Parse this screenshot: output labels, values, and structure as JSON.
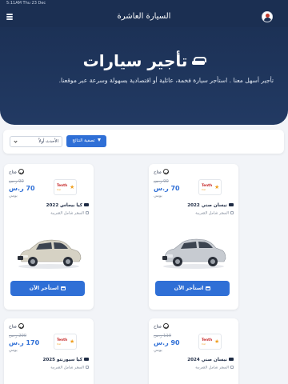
{
  "status_bar": {
    "text": "5:11AM  Thu 23 Dec"
  },
  "app_bar": {
    "title": "السيارة العاشرة"
  },
  "hero": {
    "title": "تأجير سيارات",
    "subtitle": "تأجير أسهل معنا . استأجر سيارة فخمة، عائلية أو اقتصادية بسهولة وسرعة عبر موقعنا."
  },
  "filters": {
    "filter_button_label": "تصفية النتائج",
    "sort_value": "الأحدث أولاً"
  },
  "cards": [
    {
      "status": "متاح",
      "old_price": "90 ر.س",
      "price": "70 ر.س",
      "unit": "يومي",
      "name": "نيسان صني 2022",
      "tax_note": "السعر شامل الضريبة",
      "button": "استأجر الآن",
      "logo_line1": "Tenth",
      "logo_line2": "Car",
      "car_color": "#c7cbd1"
    },
    {
      "status": "متاح",
      "old_price": "90 ر.س",
      "price": "70 ر.س",
      "unit": "يومي",
      "name": "كيا بيجاس 2022",
      "tax_note": "السعر شامل الضريبة",
      "button": "استأجر الآن",
      "logo_line1": "Tenth",
      "logo_line2": "Car",
      "car_color": "#d6d2c4"
    },
    {
      "status": "متاح",
      "old_price": "110 ر.س",
      "price": "90 ر.س",
      "unit": "يومي",
      "name": "نيسان صني 2024",
      "tax_note": "السعر شامل الضريبة",
      "logo_line1": "Tenth",
      "logo_line2": "Car"
    },
    {
      "status": "متاح",
      "old_price": "200 ر.س",
      "price": "170 ر.س",
      "unit": "يومي",
      "name": "كيا سيورنتو 2025",
      "tax_note": "السعر شامل الضريبة",
      "logo_line1": "Tenth",
      "logo_line2": "Car"
    }
  ],
  "colors": {
    "primary": "#2f6fd6",
    "header": "#1b2f52",
    "background": "#f2f4f8"
  }
}
